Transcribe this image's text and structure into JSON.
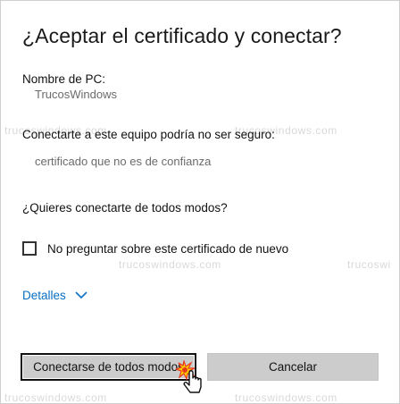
{
  "dialog": {
    "title": "¿Aceptar el certificado y conectar?",
    "pc_name_label": "Nombre de PC:",
    "pc_name_value": "TrucosWindows",
    "warning_label": "Conectarte a este equipo podría no ser seguro:",
    "warning_detail": "certificado que no es de confianza",
    "question": "¿Quieres conectarte de todos modos?",
    "checkbox_label": "No preguntar sobre este certificado de nuevo",
    "checkbox_checked": false,
    "details_label": "Detalles",
    "connect_button": "Conectarse de todos modos",
    "cancel_button": "Cancelar"
  },
  "watermarks": {
    "left": "trucoswindows.com",
    "right": "trucoswindows.com",
    "mid_left": "trucoswindows.com",
    "mid_right": "trucoswi",
    "bottom_left": "trucoswindows.com",
    "bottom_right": "trucoswindows.com"
  },
  "colors": {
    "link": "#0a6fc2",
    "button_bg": "#cccccc"
  },
  "icons": [
    "chevron-down-icon",
    "hand-pointer-icon",
    "click-burst-icon"
  ]
}
